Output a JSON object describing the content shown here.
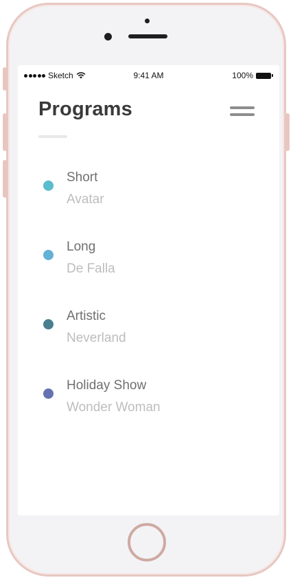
{
  "status_bar": {
    "carrier": "Sketch",
    "time": "9:41 AM",
    "battery": "100%",
    "icons": [
      "signal-dots-icon",
      "wifi-icon",
      "battery-icon"
    ]
  },
  "header": {
    "title": "Programs",
    "menu_icon": "hamburger-menu-icon"
  },
  "programs": [
    {
      "name": "Short",
      "music": "Avatar",
      "color": "#5bbccd"
    },
    {
      "name": "Long",
      "music": "De Falla",
      "color": "#64b1d6"
    },
    {
      "name": "Artistic",
      "music": "Neverland",
      "color": "#4a7f8f"
    },
    {
      "name": "Holiday Show",
      "music": "Wonder Woman",
      "color": "#6672b0"
    }
  ],
  "device": {
    "frame_color": "#e7c7c2"
  }
}
